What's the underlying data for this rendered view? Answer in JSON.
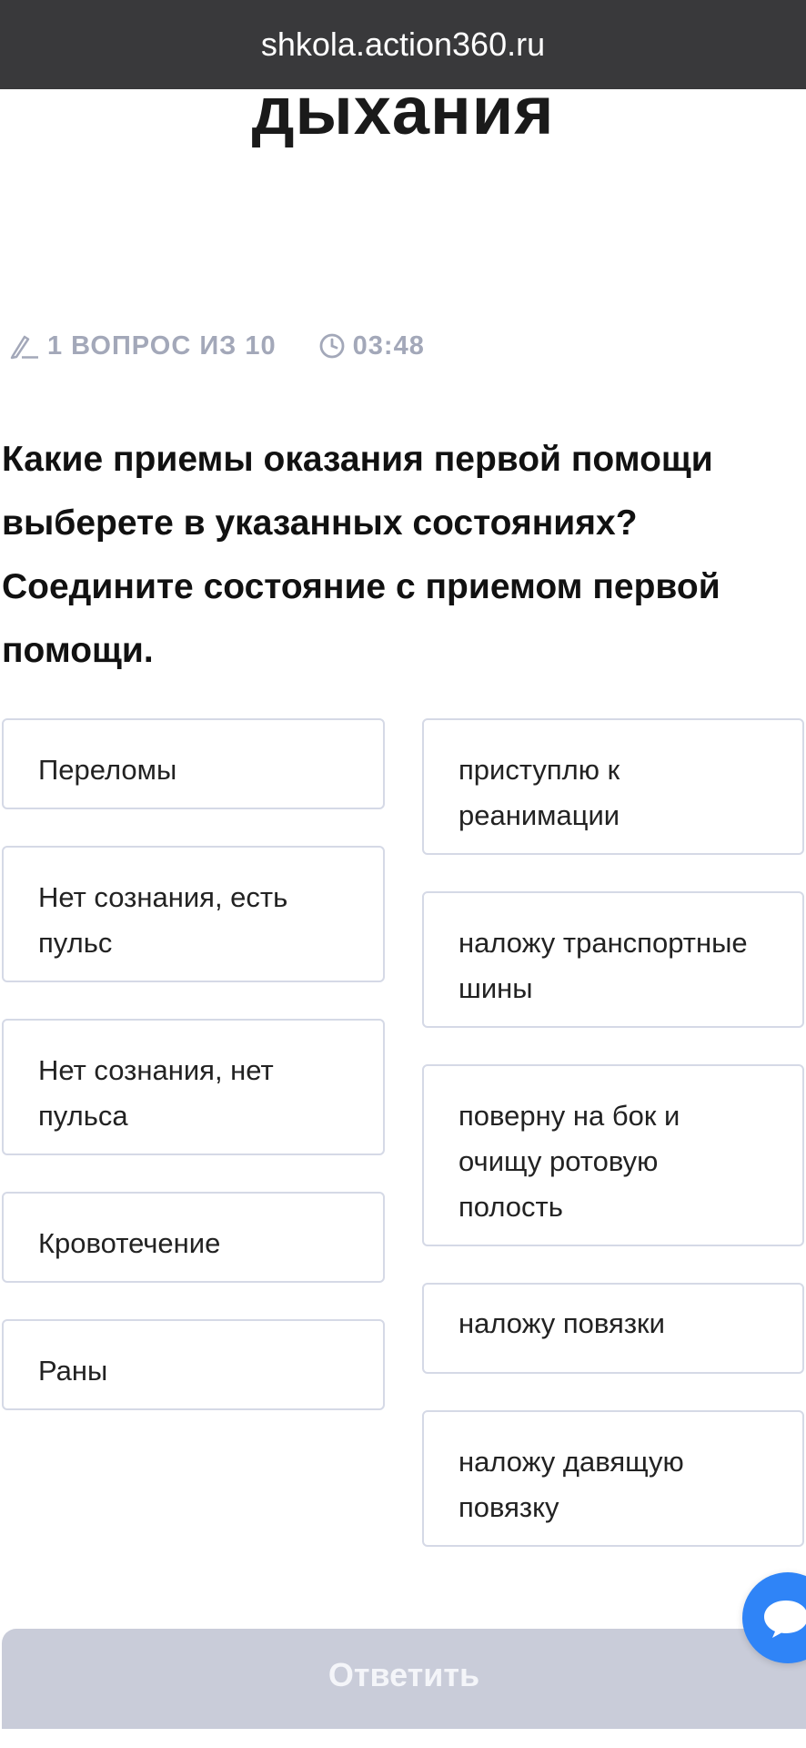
{
  "browser": {
    "url": "shkola.action360.ru"
  },
  "page": {
    "heading_fragment": "дыхания"
  },
  "quiz": {
    "progress": "1 ВОПРОС ИЗ 10",
    "timer": "03:48",
    "question": "Какие приемы оказания первой помощи выберете в указанных состояниях? Соедините состояние с приемом первой помощи.",
    "conditions": [
      "Переломы",
      "Нет сознания, есть пульс",
      "Нет сознания, нет пульса",
      "Кровотечение",
      "Раны"
    ],
    "actions": [
      "приступлю к реанимации",
      "наложу транспортные шины",
      "поверну на бок и очищу ротовую полость",
      "наложу повязки",
      "наложу давящую повязку"
    ],
    "submit_label": "Ответить"
  },
  "icons": {
    "progress": "pencil-icon",
    "timer": "clock-icon",
    "chat": "chat-icon"
  },
  "colors": {
    "accent": "#2f84f7",
    "meta_text": "#a3a8b9",
    "card_border": "#d5d9e6",
    "submit_bg": "#c9ccd9",
    "url_bar": "#39393b"
  }
}
